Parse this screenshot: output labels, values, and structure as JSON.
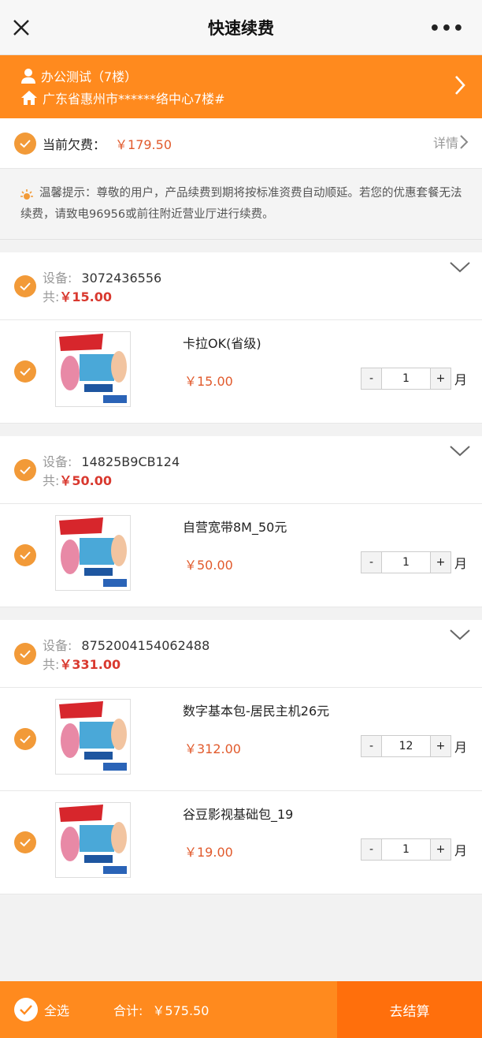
{
  "header": {
    "title": "快速续费",
    "more_label": "•••"
  },
  "address": {
    "name": "办公测试（7楼）",
    "location": "广东省惠州市******络中心7楼#"
  },
  "debt": {
    "label": "当前欠费：",
    "amount": "￥179.50",
    "detail_label": "详情"
  },
  "tip": {
    "text": "温馨提示：尊敬的用户，产品续费到期将按标准资费自动顺延。若您的优惠套餐无法续费，请致电96956或前往附近营业厅进行续费。"
  },
  "groups": [
    {
      "device_label": "设备:",
      "device_id": "3072436556",
      "total_label": "共:",
      "total": "￥15.00",
      "items": [
        {
          "name": "卡拉OK(省级)",
          "price": "￥15.00",
          "qty": "1",
          "unit": "月"
        }
      ]
    },
    {
      "device_label": "设备:",
      "device_id": "14825B9CB124",
      "total_label": "共:",
      "total": "￥50.00",
      "items": [
        {
          "name": "自营宽带8M_50元",
          "price": "￥50.00",
          "qty": "1",
          "unit": "月"
        }
      ]
    },
    {
      "device_label": "设备:",
      "device_id": "8752004154062488",
      "total_label": "共:",
      "total": "￥331.00",
      "items": [
        {
          "name": "数字基本包-居民主机26元",
          "price": "￥312.00",
          "qty": "12",
          "unit": "月"
        },
        {
          "name": "谷豆影视基础包_19",
          "price": "￥19.00",
          "qty": "1",
          "unit": "月"
        }
      ]
    }
  ],
  "stepper": {
    "minus": "-",
    "plus": "+"
  },
  "footer": {
    "select_all": "全选",
    "total_label": "合计:",
    "total": "￥575.50",
    "checkout": "去结算"
  },
  "colors": {
    "accent": "#ff8a1e",
    "price": "#e15a2c",
    "check": "#f29a38"
  }
}
